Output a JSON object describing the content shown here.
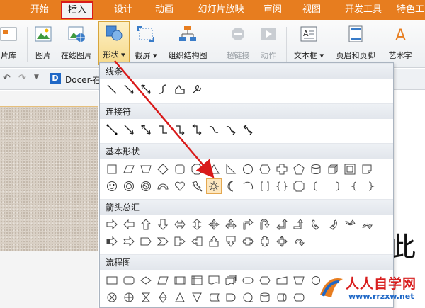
{
  "menu": {
    "tabs": [
      "开始",
      "插入",
      "设计",
      "动画",
      "幻灯片放映",
      "审阅",
      "视图",
      "开发工具",
      "特色工"
    ],
    "active": "插入"
  },
  "ribbon": {
    "items": [
      "片库",
      "图片",
      "在线图片",
      "形状",
      "截屏",
      "组织结构图",
      "超链接",
      "动作",
      "文本框",
      "页眉和页脚",
      "艺术字"
    ],
    "disabled": [
      "超链接",
      "动作"
    ]
  },
  "quickbar": {
    "doc_tab": "Docer-在"
  },
  "popup": {
    "sections": [
      "线条",
      "连接符",
      "基本形状",
      "箭头总汇",
      "流程图"
    ],
    "selected_shape": "sun-shape"
  },
  "slide": {
    "visible_text": "此"
  },
  "watermark": {
    "main": "人人自学网",
    "sub": "www.rrzxw.net"
  },
  "colors": {
    "accent": "#e77d1f",
    "highlight": "#d91a1a",
    "selection": "#fde7bf"
  }
}
